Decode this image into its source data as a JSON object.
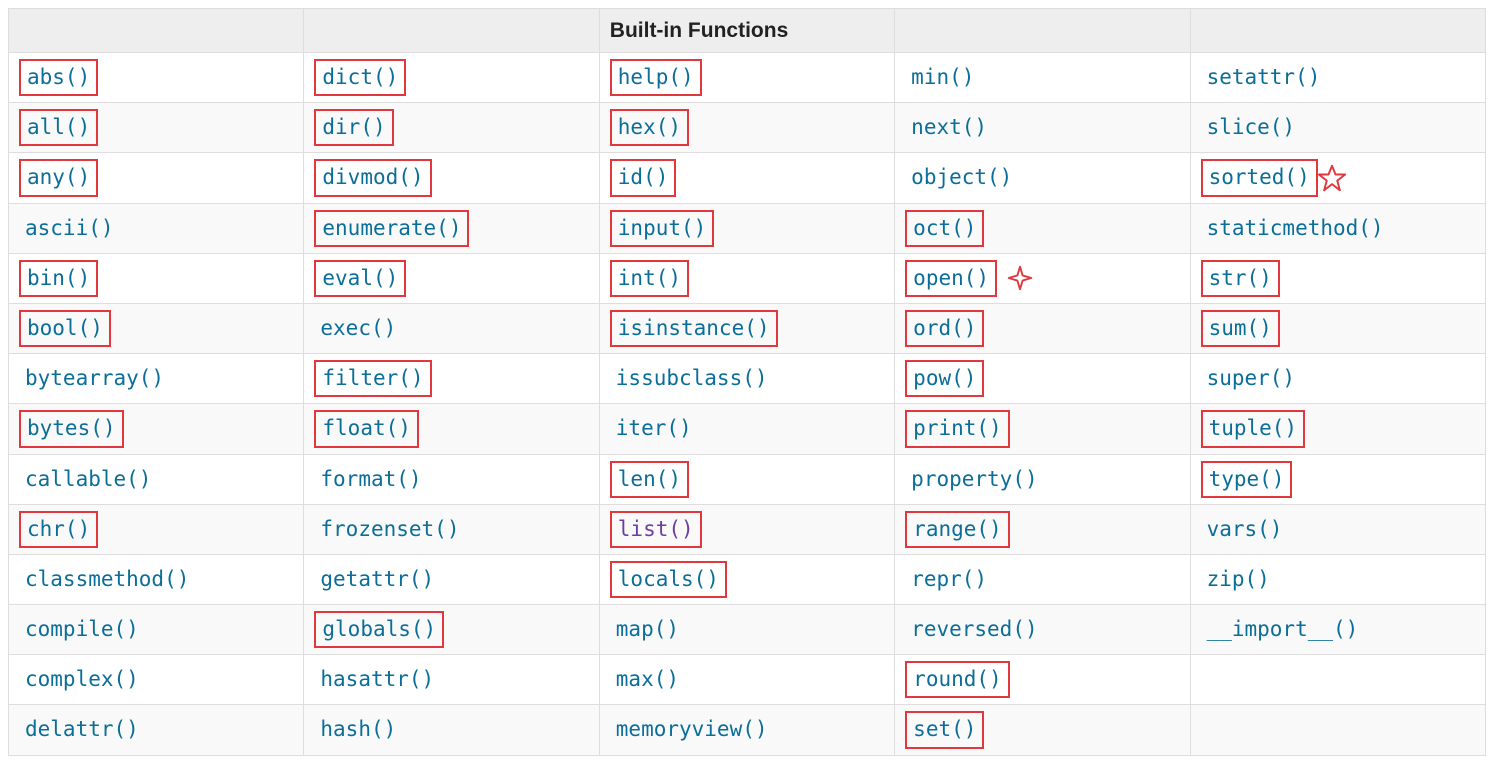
{
  "header": {
    "title": "Built-in Functions"
  },
  "columns": [
    [
      {
        "label": "abs()",
        "boxed": true
      },
      {
        "label": "all()",
        "boxed": true
      },
      {
        "label": "any()",
        "boxed": true
      },
      {
        "label": "ascii()",
        "boxed": false
      },
      {
        "label": "bin()",
        "boxed": true
      },
      {
        "label": "bool()",
        "boxed": true
      },
      {
        "label": "bytearray()",
        "boxed": false
      },
      {
        "label": "bytes()",
        "boxed": true
      },
      {
        "label": "callable()",
        "boxed": false
      },
      {
        "label": "chr()",
        "boxed": true
      },
      {
        "label": "classmethod()",
        "boxed": false
      },
      {
        "label": "compile()",
        "boxed": false
      },
      {
        "label": "complex()",
        "boxed": false
      },
      {
        "label": "delattr()",
        "boxed": false
      }
    ],
    [
      {
        "label": "dict()",
        "boxed": true
      },
      {
        "label": "dir()",
        "boxed": true
      },
      {
        "label": "divmod()",
        "boxed": true
      },
      {
        "label": "enumerate()",
        "boxed": true
      },
      {
        "label": "eval()",
        "boxed": true
      },
      {
        "label": "exec()",
        "boxed": false
      },
      {
        "label": "filter()",
        "boxed": true
      },
      {
        "label": "float()",
        "boxed": true
      },
      {
        "label": "format()",
        "boxed": false
      },
      {
        "label": "frozenset()",
        "boxed": false
      },
      {
        "label": "getattr()",
        "boxed": false
      },
      {
        "label": "globals()",
        "boxed": true
      },
      {
        "label": "hasattr()",
        "boxed": false
      },
      {
        "label": "hash()",
        "boxed": false
      }
    ],
    [
      {
        "label": "help()",
        "boxed": true
      },
      {
        "label": "hex()",
        "boxed": true
      },
      {
        "label": "id()",
        "boxed": true
      },
      {
        "label": "input()",
        "boxed": true
      },
      {
        "label": "int()",
        "boxed": true
      },
      {
        "label": "isinstance()",
        "boxed": true
      },
      {
        "label": "issubclass()",
        "boxed": false
      },
      {
        "label": "iter()",
        "boxed": false
      },
      {
        "label": "len()",
        "boxed": true
      },
      {
        "label": "list()",
        "boxed": true,
        "visited": true
      },
      {
        "label": "locals()",
        "boxed": true
      },
      {
        "label": "map()",
        "boxed": false
      },
      {
        "label": "max()",
        "boxed": false
      },
      {
        "label": "memoryview()",
        "boxed": false
      }
    ],
    [
      {
        "label": "min()",
        "boxed": false
      },
      {
        "label": "next()",
        "boxed": false
      },
      {
        "label": "object()",
        "boxed": false
      },
      {
        "label": "oct()",
        "boxed": true
      },
      {
        "label": "open()",
        "boxed": true,
        "star": "star4"
      },
      {
        "label": "ord()",
        "boxed": true
      },
      {
        "label": "pow()",
        "boxed": true
      },
      {
        "label": "print()",
        "boxed": true
      },
      {
        "label": "property()",
        "boxed": false
      },
      {
        "label": "range()",
        "boxed": true
      },
      {
        "label": "repr()",
        "boxed": false
      },
      {
        "label": "reversed()",
        "boxed": false
      },
      {
        "label": "round()",
        "boxed": true
      },
      {
        "label": "set()",
        "boxed": true
      }
    ],
    [
      {
        "label": "setattr()",
        "boxed": false
      },
      {
        "label": "slice()",
        "boxed": false
      },
      {
        "label": "sorted()",
        "boxed": true,
        "star": "star5"
      },
      {
        "label": "staticmethod()",
        "boxed": false
      },
      {
        "label": "str()",
        "boxed": true
      },
      {
        "label": "sum()",
        "boxed": true
      },
      {
        "label": "super()",
        "boxed": false
      },
      {
        "label": "tuple()",
        "boxed": true
      },
      {
        "label": "type()",
        "boxed": true
      },
      {
        "label": "vars()",
        "boxed": false
      },
      {
        "label": "zip()",
        "boxed": false
      },
      {
        "label": "__import__()",
        "boxed": false
      },
      {
        "label": "",
        "boxed": false
      },
      {
        "label": "",
        "boxed": false
      }
    ]
  ]
}
